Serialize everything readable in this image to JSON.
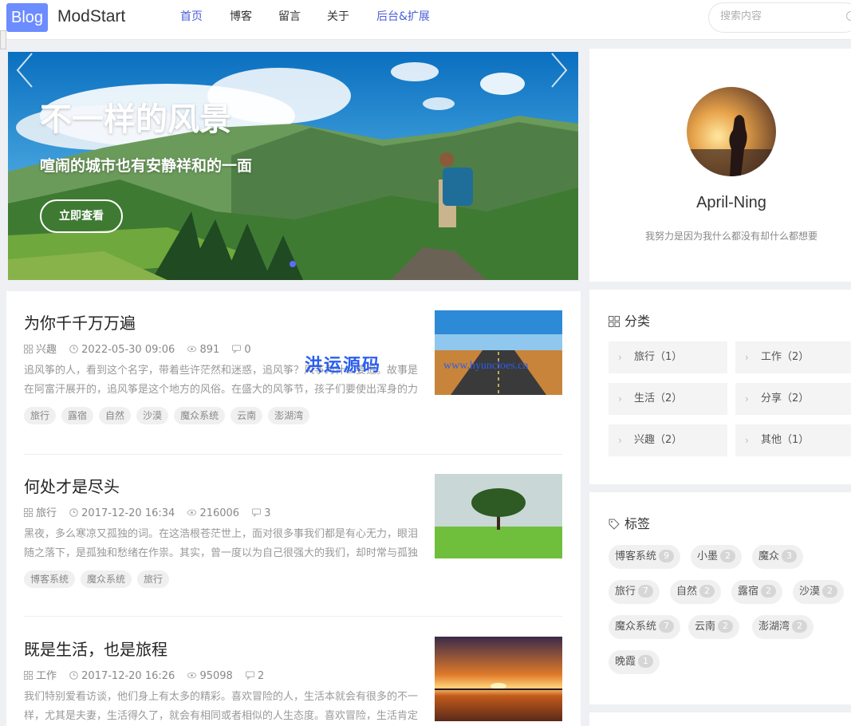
{
  "header": {
    "logo_box": "Blog",
    "logo_text": "ModStart",
    "nav": [
      "首页",
      "博客",
      "留言",
      "关于",
      "后台&扩展"
    ],
    "search_placeholder": "搜索内容"
  },
  "banner": {
    "title": "不一样的风景",
    "subtitle": "喧闹的城市也有安静祥和的一面",
    "button": "立即查看"
  },
  "profile": {
    "name": "April-Ning",
    "bio": "我努力是因为我什么都没有却什么都想要"
  },
  "articles": [
    {
      "title": "为你千千万万遍",
      "category": "兴趣",
      "date": "2022-05-30 09:06",
      "views": "891",
      "comments": "0",
      "excerpt": "追风筝的人，看到这个名字，带着些许茫然和迷惑，追风筝？风筝为什么要追。故事是在阿富汗展开的，追风筝是这个地方的风俗。在盛大的风筝节，孩子们要使出浑身的力",
      "tags": [
        "旅行",
        "露宿",
        "自然",
        "沙漠",
        "魔众系统",
        "云南",
        "澎湖湾"
      ]
    },
    {
      "title": "何处才是尽头",
      "category": "旅行",
      "date": "2017-12-20 16:34",
      "views": "216006",
      "comments": "3",
      "excerpt": "黑夜，多么寒凉又孤独的词。在这浩根苍茫世上，面对很多事我们都是有心无力，眼泪随之落下，是孤独和愁绪在作祟。其实，曾一度以为自己很强大的我们，却时常与孤独",
      "tags": [
        "博客系统",
        "魔众系统",
        "旅行"
      ]
    },
    {
      "title": "既是生活，也是旅程",
      "category": "工作",
      "date": "2017-12-20 16:26",
      "views": "95098",
      "comments": "2",
      "excerpt": "我们特别爱看访谈，他们身上有太多的精彩。喜欢冒险的人，生活本就会有很多的不一样，尤其是夫妻，生活得久了，就会有相同或者相似的人生态度。喜欢冒险，生活肯定",
      "tags": []
    }
  ],
  "watermark": {
    "cn": "洪运源码",
    "url": "www.hyuncloes.cn"
  },
  "categories": {
    "heading": "分类",
    "items": [
      "旅行（1）",
      "工作（2）",
      "生活（2）",
      "分享（2）",
      "兴趣（2）",
      "其他（1）"
    ]
  },
  "tag_cloud": {
    "heading": "标签",
    "items": [
      {
        "name": "博客系统",
        "count": "9"
      },
      {
        "name": "小墨",
        "count": "2"
      },
      {
        "name": "魔众",
        "count": "3"
      },
      {
        "name": "旅行",
        "count": "7"
      },
      {
        "name": "自然",
        "count": "2"
      },
      {
        "name": "露宿",
        "count": "2"
      },
      {
        "name": "沙漠",
        "count": "2"
      },
      {
        "name": "魔众系统",
        "count": "7"
      },
      {
        "name": "云南",
        "count": "2"
      },
      {
        "name": "澎湖湾",
        "count": "2"
      },
      {
        "name": "晚霞",
        "count": "1"
      }
    ]
  },
  "colors": {
    "accent": "#4a5fd8",
    "logo_bg": "#6c8cff",
    "watermark": "#2a5ef0"
  }
}
